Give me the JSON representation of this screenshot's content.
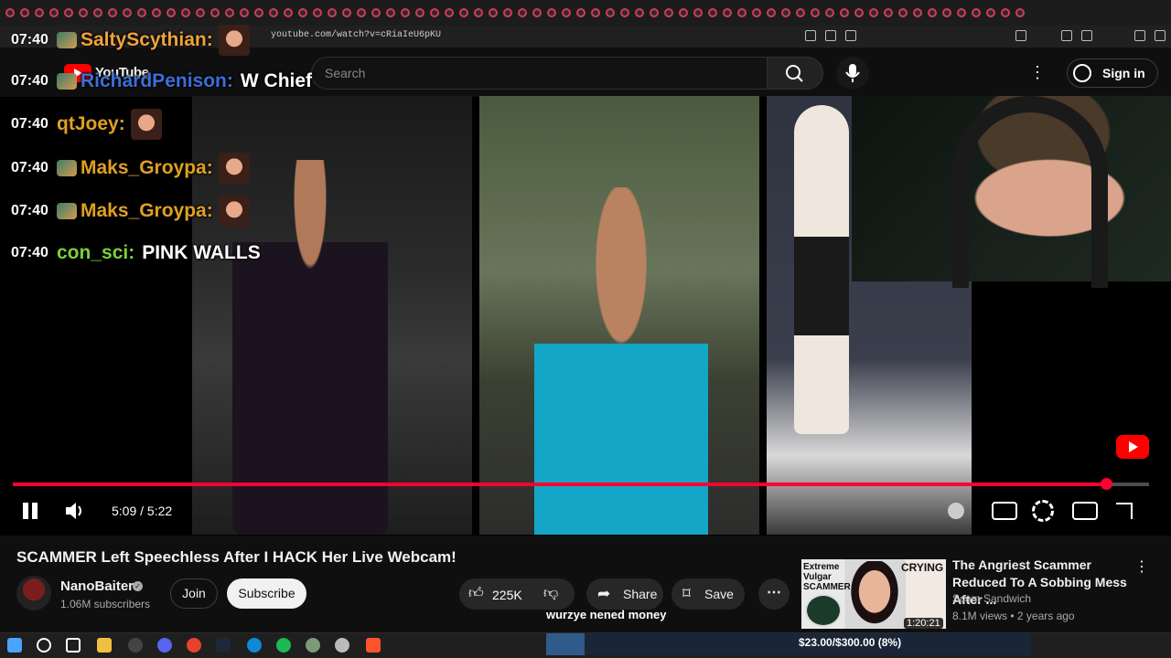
{
  "browser": {
    "url": "youtube.com/watch?v=cRiaIeU6pKU"
  },
  "youtube": {
    "logo_text": "YouTube",
    "search_placeholder": "Search",
    "sign_in": "Sign in"
  },
  "chat": [
    {
      "time": "07:40",
      "user": "SaltyScythian",
      "message": "",
      "color": "#f0a23a",
      "emote": true
    },
    {
      "time": "07:40",
      "user": "RichardPenison",
      "message": "W Chief",
      "color": "#3b6fd8",
      "emote": false
    },
    {
      "time": "07:40",
      "user": "qtJoey",
      "message": "",
      "color": "#e0a020",
      "emote": true
    },
    {
      "time": "07:40",
      "user": "Maks_Groypa",
      "message": "",
      "color": "#e0a020",
      "emote": true
    },
    {
      "time": "07:40",
      "user": "Maks_Groypa",
      "message": "",
      "color": "#e0a020",
      "emote": true
    },
    {
      "time": "07:40",
      "user": "con_sci",
      "message": "PINK WALLS",
      "color": "#7ad13a",
      "emote": false
    }
  ],
  "player": {
    "current_time": "5:09",
    "duration": "5:22",
    "time_display": "5:09 / 5:22",
    "progress_fraction": 0.962
  },
  "video": {
    "title": "SCAMMER Left Speechless After I HACK Her Live Webcam!",
    "channel": "NanoBaiter",
    "subscribers": "1.06M subscribers",
    "join_label": "Join",
    "subscribe_label": "Subscribe",
    "likes": "225K",
    "share_label": "Share",
    "save_label": "Save",
    "caption": "wurzye nened money"
  },
  "recommendation": {
    "title": "The Angriest Scammer Reduced To A Sobbing Mess After ...",
    "channel": "Scam Sandwich",
    "meta": "8.1M views • 2 years ago",
    "duration": "1:20:21",
    "thumb_text_left": "Extreme Vulgar SCAMMER",
    "thumb_text_right": "CRYING"
  },
  "donation_goal": {
    "text": "$23.00/$300.00 (8%)",
    "fraction": 0.08
  },
  "colors": {
    "accent": "#ff0033",
    "background": "#0f0f0f"
  }
}
